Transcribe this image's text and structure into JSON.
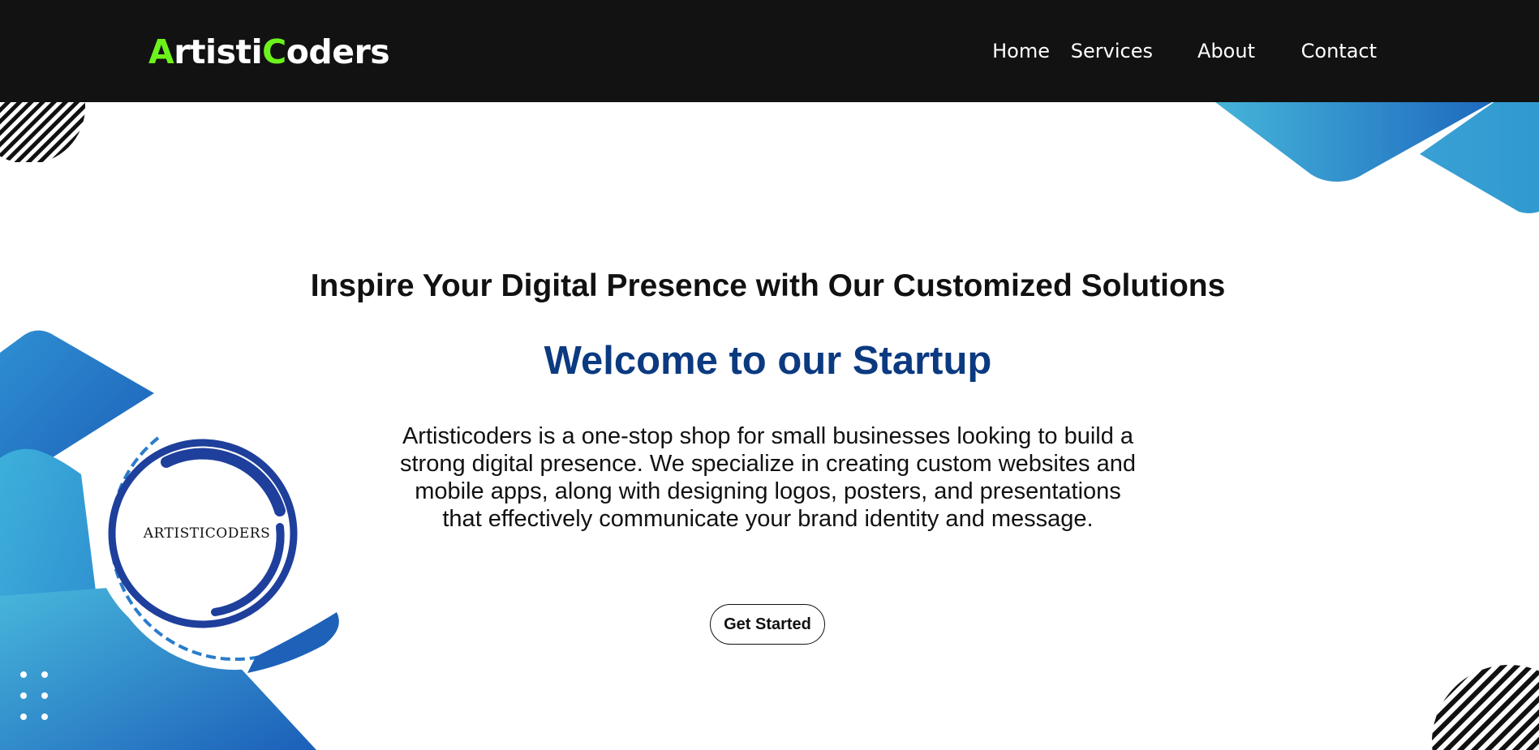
{
  "header": {
    "logo": {
      "first_letter": "A",
      "part1": "rtisti",
      "second_letter": "C",
      "part2": "oders"
    },
    "nav": [
      {
        "label": "Home"
      },
      {
        "label": "Services"
      },
      {
        "label": "About"
      },
      {
        "label": "Contact"
      }
    ]
  },
  "hero": {
    "tagline": "Inspire Your Digital Presence with Our Customized Solutions",
    "title": "Welcome to our Startup",
    "description": "Artisticoders is a one-stop shop for small businesses looking to build a strong digital presence. We specialize in creating custom websites and mobile apps, along with designing logos, posters, and presentations that effectively communicate your brand identity and message.",
    "cta_label": "Get Started"
  },
  "brand_badge": {
    "text": "ARTISTICODERS"
  },
  "colors": {
    "navbar_bg": "#121212",
    "logo_accent": "#6cf31c",
    "title_blue": "#0b3a80",
    "shape_blue_light": "#45b4d8",
    "shape_blue_dark": "#1c6dc0",
    "swirl_blue": "#1f3f9c"
  },
  "icons": {
    "stripe_circle_top_left": "striped-circle-icon",
    "stripe_circle_bottom_right": "striped-circle-icon",
    "dots_grid": "dots-grid-icon"
  }
}
